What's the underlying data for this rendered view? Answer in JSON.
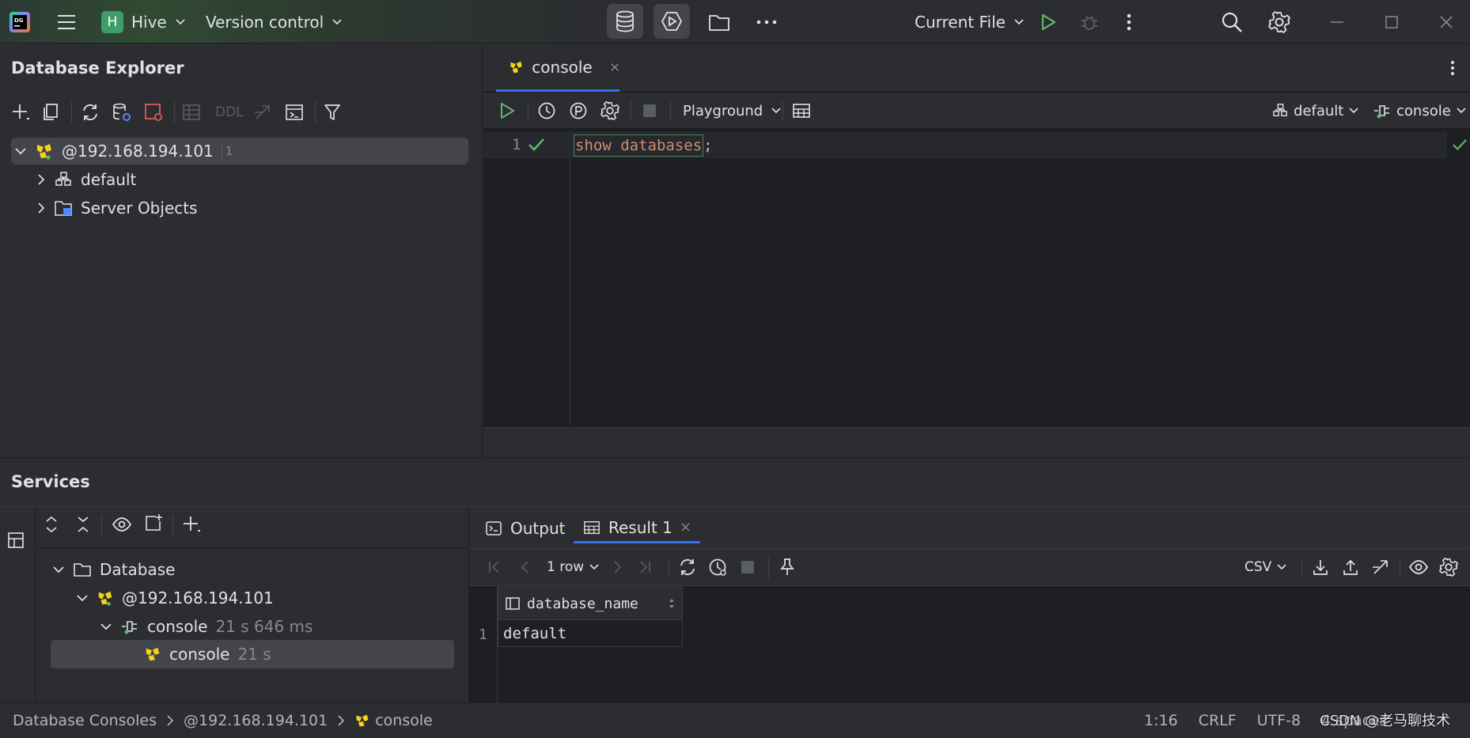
{
  "titlebar": {
    "project_badge": "H",
    "project_name": "Hive",
    "vcs_label": "Version control",
    "run_config": "Current File"
  },
  "explorer": {
    "title": "Database Explorer",
    "toolbar_ddl": "DDL",
    "connection": {
      "label": "@192.168.194.101",
      "count": "1"
    },
    "children": [
      {
        "label": "default",
        "icon": "schema-icon"
      },
      {
        "label": "Server Objects",
        "icon": "server-objects-icon"
      }
    ]
  },
  "editor": {
    "tab_label": "console",
    "mode": "Playground",
    "schema": "default",
    "session": "console",
    "line_number": "1",
    "code_keyword": "show databases",
    "code_rest": ";"
  },
  "services": {
    "title": "Services",
    "tree": [
      {
        "label": "Database",
        "meta": ""
      },
      {
        "label": "@192.168.194.101",
        "meta": ""
      },
      {
        "label": "console",
        "meta": "21 s 646 ms"
      },
      {
        "label": "console",
        "meta": "21 s"
      }
    ],
    "tabs": {
      "output": "Output",
      "result": "Result 1"
    },
    "row_count": "1 row",
    "export_format": "CSV",
    "table": {
      "column": "database_name",
      "rows": [
        {
          "n": "1",
          "value": "default"
        }
      ]
    }
  },
  "statusbar": {
    "breadcrumb": [
      "Database Consoles",
      "@192.168.194.101",
      "console"
    ],
    "position": "1:16",
    "line_ending": "CRLF",
    "encoding": "UTF-8",
    "indent": "4 spaces",
    "watermark": "CSDN @老马聊技术"
  },
  "colors": {
    "accent_green": "#5fb865",
    "hive_yellow": "#f5d31a",
    "keyword": "#cf8e6d"
  }
}
